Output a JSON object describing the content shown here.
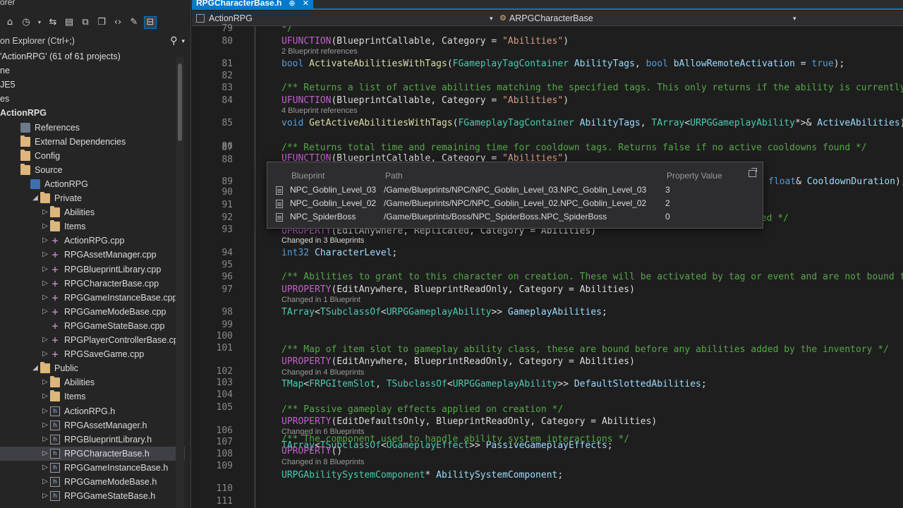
{
  "explorer": {
    "title": "orer",
    "search_placeholder": "on Explorer (Ctrl+;)",
    "toolbar_icons": [
      "home-icon",
      "history-icon",
      "sync-icon",
      "switch-views-icon",
      "collapse-all-icon",
      "show-files-icon",
      "code-view-icon",
      "properties-icon",
      "preview-icon"
    ],
    "tree": [
      {
        "label": "'ActionRPG' (61 of 61 projects)",
        "icon": "none",
        "expander": ""
      },
      {
        "label": "ne",
        "icon": "none",
        "expander": ""
      },
      {
        "label": "JE5",
        "icon": "none",
        "expander": ""
      },
      {
        "label": "es",
        "icon": "none",
        "expander": ""
      },
      {
        "label": "ActionRPG",
        "icon": "none",
        "expander": "",
        "bold": true
      },
      {
        "label": "References",
        "icon": "references-icon",
        "expander": ""
      },
      {
        "label": "External Dependencies",
        "icon": "folder-icon",
        "expander": ""
      },
      {
        "label": "Config",
        "icon": "folder-icon",
        "expander": ""
      },
      {
        "label": "Source",
        "icon": "folder-icon",
        "expander": ""
      },
      {
        "label": "ActionRPG",
        "icon": "project-icon",
        "expander": ""
      },
      {
        "label": "Private",
        "icon": "folder-icon",
        "expander": "◢"
      },
      {
        "label": "Abilities",
        "icon": "folder-icon",
        "expander": "▷"
      },
      {
        "label": "Items",
        "icon": "folder-icon",
        "expander": "▷"
      },
      {
        "label": "ActionRPG.cpp",
        "icon": "cpp-file-icon",
        "expander": "▷"
      },
      {
        "label": "RPGAssetManager.cpp",
        "icon": "cpp-file-icon",
        "expander": "▷"
      },
      {
        "label": "RPGBlueprintLibrary.cpp",
        "icon": "cpp-file-icon",
        "expander": "▷"
      },
      {
        "label": "RPGCharacterBase.cpp",
        "icon": "cpp-file-icon",
        "expander": "▷"
      },
      {
        "label": "RPGGameInstanceBase.cpp",
        "icon": "cpp-file-icon",
        "expander": "▷"
      },
      {
        "label": "RPGGameModeBase.cpp",
        "icon": "cpp-file-icon",
        "expander": "▷"
      },
      {
        "label": "RPGGameStateBase.cpp",
        "icon": "cpp-file-icon",
        "expander": ""
      },
      {
        "label": "RPGPlayerControllerBase.cpp",
        "icon": "cpp-file-icon",
        "expander": "▷"
      },
      {
        "label": "RPGSaveGame.cpp",
        "icon": "cpp-file-icon",
        "expander": "▷"
      },
      {
        "label": "Public",
        "icon": "folder-icon",
        "expander": "◢"
      },
      {
        "label": "Abilities",
        "icon": "folder-icon",
        "expander": "▷"
      },
      {
        "label": "Items",
        "icon": "folder-icon",
        "expander": "▷"
      },
      {
        "label": "ActionRPG.h",
        "icon": "header-file-icon",
        "expander": "▷"
      },
      {
        "label": "RPGAssetManager.h",
        "icon": "header-file-icon",
        "expander": "▷"
      },
      {
        "label": "RPGBlueprintLibrary.h",
        "icon": "header-file-icon",
        "expander": "▷"
      },
      {
        "label": "RPGCharacterBase.h",
        "icon": "header-file-icon",
        "expander": "▷",
        "selected": true
      },
      {
        "label": "RPGGameInstanceBase.h",
        "icon": "header-file-icon",
        "expander": "▷"
      },
      {
        "label": "RPGGameModeBase.h",
        "icon": "header-file-icon",
        "expander": "▷"
      },
      {
        "label": "RPGGameStateBase.h",
        "icon": "header-file-icon",
        "expander": "▷"
      }
    ]
  },
  "editor": {
    "tab": {
      "title": "RPGCharacterBase.h",
      "pin": "⊕",
      "close": "✕"
    },
    "nav": {
      "project": "ActionRPG",
      "member": "ARPGCharacterBase"
    },
    "line_numbers": [
      "79",
      "80",
      "81",
      "82",
      "83",
      "84",
      "85",
      "86",
      "87",
      "88",
      "89",
      "90",
      "91",
      "92",
      "93",
      "94",
      "95",
      "96",
      "97",
      "98",
      "99",
      "100",
      "101",
      "102",
      "103",
      "104",
      "105",
      "106",
      "107",
      "108",
      "109",
      "110",
      "111"
    ],
    "code": [
      [
        [
          "cm",
          "*/"
        ]
      ],
      [
        [
          "mac",
          "UFUNCTION"
        ],
        [
          "pl",
          "(BlueprintCallable, Category = "
        ],
        [
          "st",
          "\"Abilities\""
        ],
        [
          "pl",
          ")"
        ]
      ],
      [
        [
          "gy",
          "2 Blueprint references"
        ]
      ],
      [
        [
          "kw",
          "bool "
        ],
        [
          "fn",
          "ActivateAbilitiesWithTags"
        ],
        [
          "pl",
          "("
        ],
        [
          "ty",
          "FGameplayTagContainer"
        ],
        [
          "pm",
          " AbilityTags"
        ],
        [
          "pl",
          ", "
        ],
        [
          "kw",
          "bool"
        ],
        [
          "pm",
          " bAllowRemoteActivation"
        ],
        [
          "pl",
          " = "
        ],
        [
          "kw",
          "true"
        ],
        [
          "pl",
          ");"
        ]
      ],
      [],
      [
        [
          "cm",
          "/** Returns a list of active abilities matching the specified tags. This only returns if the ability is currently r"
        ]
      ],
      [
        [
          "mac",
          "UFUNCTION"
        ],
        [
          "pl",
          "(BlueprintCallable, Category = "
        ],
        [
          "st",
          "\"Abilities\""
        ],
        [
          "pl",
          ")"
        ]
      ],
      [
        [
          "gy",
          "4 Blueprint references"
        ]
      ],
      [
        [
          "kw",
          "void "
        ],
        [
          "fn",
          "GetActiveAbilitiesWithTags"
        ],
        [
          "pl",
          "("
        ],
        [
          "ty",
          "FGameplayTagContainer"
        ],
        [
          "pm",
          " AbilityTags"
        ],
        [
          "pl",
          ", "
        ],
        [
          "ty",
          "TArray"
        ],
        [
          "pl",
          "<"
        ],
        [
          "ty",
          "URPGGameplayAbility"
        ],
        [
          "pl",
          "*>& "
        ],
        [
          "pm",
          "ActiveAbilities"
        ],
        [
          "pl",
          ");"
        ]
      ],
      [],
      [
        [
          "cm",
          "/** Returns total time and remaining time for cooldown tags. Returns false if no active cooldowns found */"
        ]
      ],
      [
        [
          "mac",
          "UFUNCTION"
        ],
        [
          "pl",
          "(BlueprintCallable, Category = "
        ],
        [
          "st",
          "\"Abilities\""
        ],
        [
          "pl",
          ")"
        ]
      ],
      [
        [
          "kw",
          "float"
        ],
        [
          "pl",
          "& "
        ],
        [
          "pm",
          "CooldownDuration"
        ],
        [
          "pl",
          ");"
        ]
      ],
      [
        [
          "kw",
          "pr"
        ]
      ],
      [
        [
          "cm",
          "ned */"
        ]
      ],
      [
        [
          "mac",
          "UPROPERTY"
        ],
        [
          "pl",
          "(EditAnywhere, Replicated, Category = Abilities)"
        ]
      ],
      [
        [
          "pl",
          "Changed in 3 Blueprints"
        ]
      ],
      [
        [
          "kw",
          "int32 "
        ],
        [
          "pm",
          "CharacterLevel"
        ],
        [
          "pl",
          ";"
        ]
      ],
      [],
      [
        [
          "cm",
          "/** Abilities to grant to this character on creation. These will be activated by tag or event and are not bound to"
        ]
      ],
      [
        [
          "mac",
          "UPROPERTY"
        ],
        [
          "pl",
          "(EditAnywhere, BlueprintReadOnly, Category = Abilities)"
        ]
      ],
      [
        [
          "gy",
          "Changed in 1 Blueprint"
        ]
      ],
      [
        [
          "ty",
          "TArray"
        ],
        [
          "pl",
          "<"
        ],
        [
          "ty",
          "TSubclassOf"
        ],
        [
          "pl",
          "<"
        ],
        [
          "ty",
          "URPGGameplayAbility"
        ],
        [
          "pl",
          ">> "
        ],
        [
          "pm",
          "GameplayAbilities"
        ],
        [
          "pl",
          ";"
        ]
      ],
      [],
      [
        [
          "cm",
          "/** Map of item slot to gameplay ability class, these are bound before any abilities added by the inventory */"
        ]
      ],
      [
        [
          "mac",
          "UPROPERTY"
        ],
        [
          "pl",
          "(EditAnywhere, BlueprintReadOnly, Category = Abilities)"
        ]
      ],
      [
        [
          "gy",
          "Changed in 4 Blueprints"
        ]
      ],
      [
        [
          "ty",
          "TMap"
        ],
        [
          "pl",
          "<"
        ],
        [
          "ty",
          "FRPGItemSlot"
        ],
        [
          "pl",
          ", "
        ],
        [
          "ty",
          "TSubclassOf"
        ],
        [
          "pl",
          "<"
        ],
        [
          "ty",
          "URPGGameplayAbility"
        ],
        [
          "pl",
          ">> "
        ],
        [
          "pm",
          "DefaultSlottedAbilities"
        ],
        [
          "pl",
          ";"
        ]
      ],
      [],
      [
        [
          "cm",
          "/** Passive gameplay effects applied on creation */"
        ]
      ],
      [
        [
          "mac",
          "UPROPERTY"
        ],
        [
          "pl",
          "(EditDefaultsOnly, BlueprintReadOnly, Category = Abilities)"
        ]
      ],
      [
        [
          "gy",
          "Changed in 6 Blueprints"
        ]
      ],
      [
        [
          "ty",
          "TArray"
        ],
        [
          "pl",
          "<"
        ],
        [
          "ty",
          "TSubclassOf"
        ],
        [
          "pl",
          "<"
        ],
        [
          "ty",
          "UGameplayEffect"
        ],
        [
          "pl",
          ">> "
        ],
        [
          "pm",
          "PassiveGameplayEffects"
        ],
        [
          "pl",
          ";"
        ]
      ],
      [],
      [
        [
          "cm",
          "/** The component used to handle ability system interactions */"
        ]
      ],
      [
        [
          "mac",
          "UPROPERTY"
        ],
        [
          "pl",
          "()"
        ]
      ],
      [
        [
          "gy",
          "Changed in 8 Blueprints"
        ]
      ],
      [
        [
          "ty",
          "URPGAbilitySystemComponent"
        ],
        [
          "pl",
          "* "
        ],
        [
          "pm",
          "AbilitySystemComponent"
        ],
        [
          "pl",
          ";"
        ]
      ]
    ]
  },
  "popup": {
    "headers": {
      "blueprint": "Blueprint",
      "path": "Path",
      "value": "Property Value"
    },
    "rows": [
      {
        "blueprint": "NPC_Goblin_Level_03",
        "path": "/Game/Blueprints/NPC/NPC_Goblin_Level_03.NPC_Goblin_Level_03",
        "value": "3"
      },
      {
        "blueprint": "NPC_Goblin_Level_02",
        "path": "/Game/Blueprints/NPC/NPC_Goblin_Level_02.NPC_Goblin_Level_02",
        "value": "2"
      },
      {
        "blueprint": "NPC_SpiderBoss",
        "path": "/Game/Blueprints/Boss/NPC_SpiderBoss.NPC_SpiderBoss",
        "value": "0"
      }
    ]
  }
}
